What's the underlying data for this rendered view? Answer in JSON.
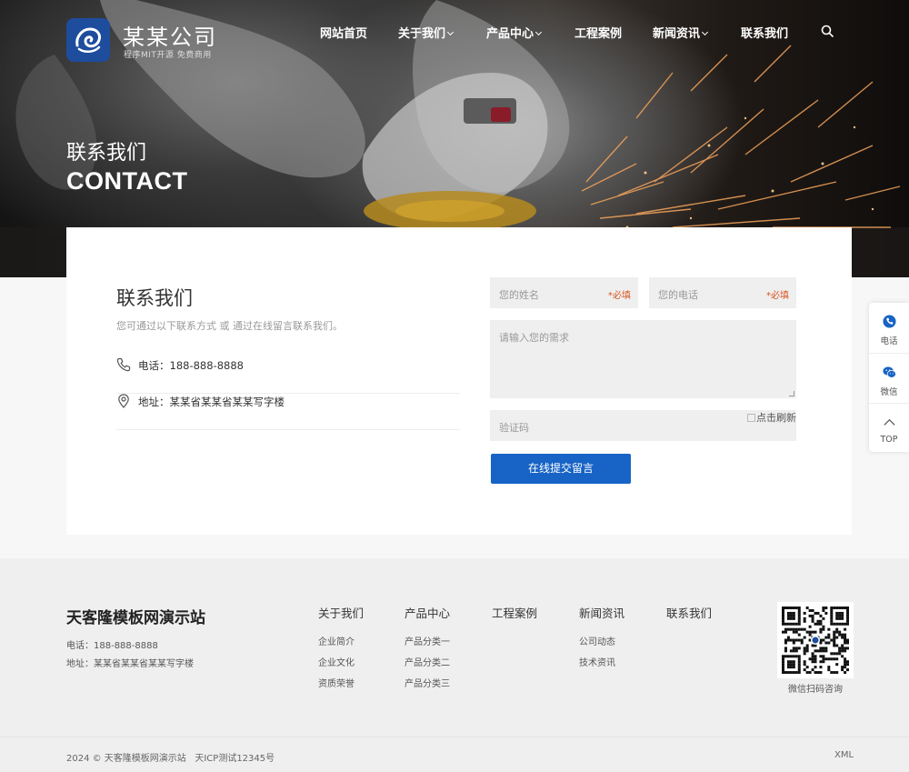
{
  "brand": {
    "title": "某某公司",
    "subtitle": "程序MIT开源 免费商用",
    "color": "#1d4d9c"
  },
  "nav": {
    "items": [
      {
        "label": "网站首页",
        "dropdown": false
      },
      {
        "label": "关于我们",
        "dropdown": true
      },
      {
        "label": "产品中心",
        "dropdown": true
      },
      {
        "label": "工程案例",
        "dropdown": false
      },
      {
        "label": "新闻资讯",
        "dropdown": true
      },
      {
        "label": "联系我们",
        "dropdown": false
      }
    ],
    "search_icon": "search-icon"
  },
  "hero": {
    "title_cn": "联系我们",
    "title_en": "CONTACT"
  },
  "contact": {
    "title": "联系我们",
    "description": "您可通过以下联系方式 或 通过在线留言联系我们。",
    "phone": "电话：188-888-8888",
    "address": "地址：某某省某某省某某写字楼"
  },
  "form": {
    "name_placeholder": "您的姓名",
    "name_required": "*必填",
    "phone_placeholder": "您的电话",
    "phone_required": "*必填",
    "message_placeholder": "请输入您的需求",
    "captcha_placeholder": "验证码",
    "captcha_image_alt": "点击刷新",
    "submit_label": "在线提交留言",
    "accent": "#1763c6"
  },
  "side_float": {
    "items": [
      {
        "label": "电话",
        "icon": "phone-icon"
      },
      {
        "label": "微信",
        "icon": "wechat-icon"
      },
      {
        "label": "TOP",
        "icon": "chevron-up-icon"
      }
    ]
  },
  "footer": {
    "brand": "天客隆模板网演示站",
    "phone": "电话：188-888-8888",
    "address": "地址：某某省某某省某某写字楼",
    "columns": [
      {
        "heading": "关于我们",
        "links": [
          "企业简介",
          "企业文化",
          "资质荣誉"
        ]
      },
      {
        "heading": "产品中心",
        "links": [
          "产品分类一",
          "产品分类二",
          "产品分类三"
        ]
      },
      {
        "heading": "工程案例",
        "links": []
      },
      {
        "heading": "新闻资讯",
        "links": [
          "公司动态",
          "技术资讯"
        ]
      },
      {
        "heading": "联系我们",
        "links": []
      }
    ],
    "qr_caption": "微信扫码咨询",
    "copyright": "2024 © 天客隆模板网演示站",
    "icp": "天ICP测试12345号",
    "xml": "XML"
  }
}
